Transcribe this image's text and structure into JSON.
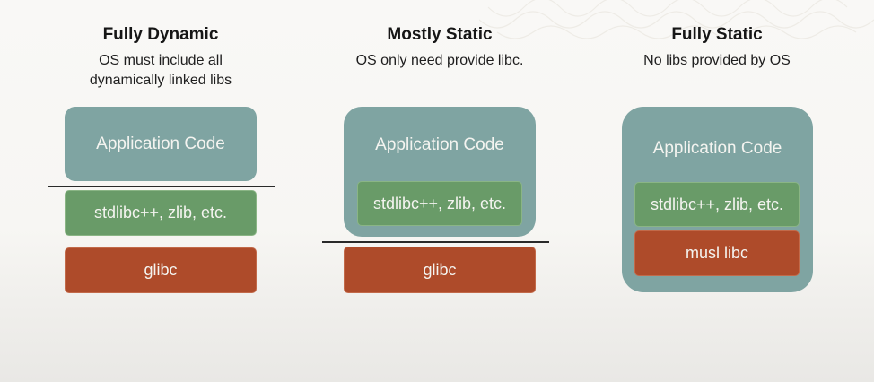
{
  "columns": [
    {
      "title": "Fully Dynamic",
      "subtitle_line1": "OS must include all",
      "subtitle_line2": "dynamically linked libs",
      "app_label": "Application Code",
      "libs_label": "stdlibc++, zlib, etc.",
      "libc_label": "glibc"
    },
    {
      "title": "Mostly Static",
      "subtitle_line1": "OS only need provide libc.",
      "app_label": "Application Code",
      "libs_label": "stdlibc++, zlib, etc.",
      "libc_label": "glibc"
    },
    {
      "title": "Fully Static",
      "subtitle_line1": "No libs provided by OS",
      "app_label": "Application Code",
      "libs_label": "stdlibc++, zlib, etc.",
      "libc_label": "musl libc"
    }
  ],
  "colors": {
    "app": "#7fa4a2",
    "libs": "#699b68",
    "libc": "#ae4b2a",
    "divider": "#2a2a2a",
    "background": "#f8f7f4"
  }
}
